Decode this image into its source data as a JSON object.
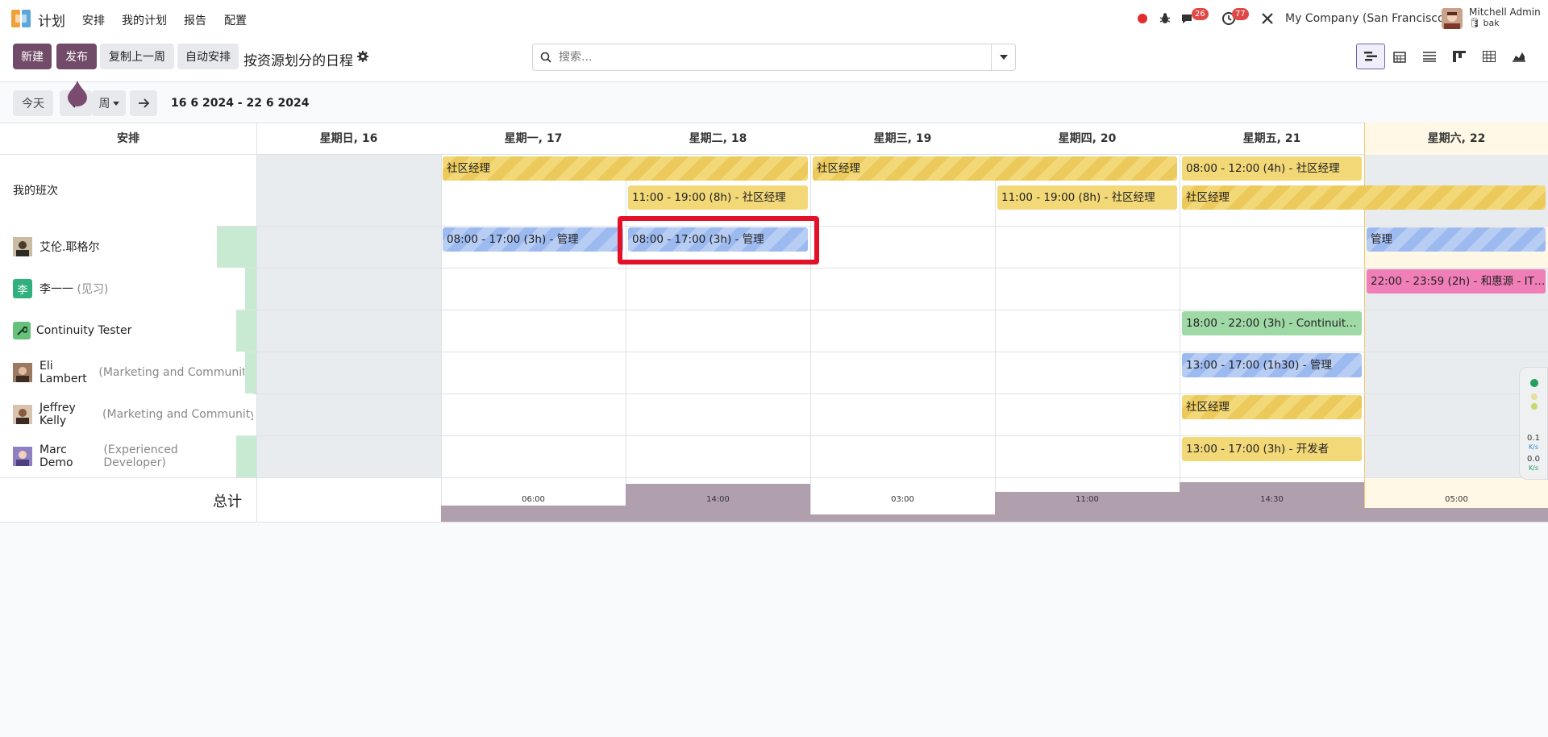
{
  "navbar": {
    "app_name": "计划",
    "menu": [
      "安排",
      "我的计划",
      "报告",
      "配置"
    ],
    "messages_count": "26",
    "activities_count": "77",
    "company": "My Company (San Francisco)",
    "user_name": "Mitchell Admin",
    "user_db": "bak"
  },
  "control": {
    "new_label": "新建",
    "publish_label": "发布",
    "copy_prev_label": "复制上一周",
    "auto_plan_label": "自动安排",
    "title": "按资源划分的日程",
    "search_placeholder": "搜索..."
  },
  "datenav": {
    "today_label": "今天",
    "scale_label": "周",
    "range": "16 6 2024 - 22 6 2024"
  },
  "gantt": {
    "group_header": "安排",
    "columns": [
      "星期日, 16",
      "星期一, 17",
      "星期二, 18",
      "星期三, 19",
      "星期四, 20",
      "星期五, 21",
      "星期六, 22"
    ],
    "rows": [
      {
        "name": "我的班次",
        "role": ""
      },
      {
        "name": "艾伦.耶格尔",
        "role": ""
      },
      {
        "name": "李一一",
        "role": "(见习)"
      },
      {
        "name": "Continuity Tester",
        "role": ""
      },
      {
        "name": "Eli Lambert",
        "role": "(Marketing and Community ..."
      },
      {
        "name": "Jeffrey Kelly",
        "role": "(Marketing and Community ..."
      },
      {
        "name": "Marc Demo",
        "role": "(Experienced Developer)"
      }
    ],
    "avatar_initial_li": "李",
    "shifts": {
      "my_1": "社区经理",
      "my_2": "社区经理",
      "my_3": "08:00 - 12:00 (4h) - 社区经理",
      "my_4": "11:00 - 19:00 (8h) - 社区经理",
      "my_5": "11:00 - 19:00 (8h) - 社区经理",
      "my_6": "社区经理",
      "allen_1": "08:00 - 17:00 (3h) - 管理",
      "allen_2": "08:00 - 17:00 (3h) - 管理",
      "allen_3": "管理",
      "li_1": "22:00 - 23:59 (2h) - 和惠源 - IT技...",
      "ct_1": "18:00 - 22:00 (3h) - Continuity Te...",
      "eli_1": "13:00 - 17:00 (1h30) - 管理",
      "jeff_1": "社区经理",
      "marc_1": "13:00 - 17:00 (3h) - 开发者"
    },
    "total_label": "总计",
    "totals": [
      "06:00",
      "14:00",
      "03:00",
      "11:00",
      "14:30",
      "05:00"
    ]
  },
  "widget": {
    "up_speed": "0.1",
    "down_speed": "0.0",
    "unit": "K/s"
  }
}
